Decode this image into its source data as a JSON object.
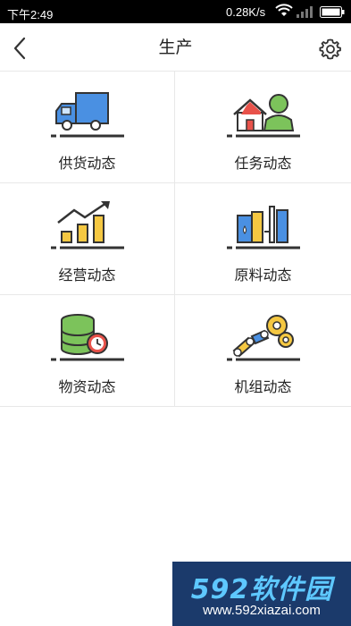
{
  "status_bar": {
    "time": "下午2:49",
    "speed": "0.28K/s"
  },
  "header": {
    "title": "生产"
  },
  "grid": [
    {
      "label": "供货动态",
      "icon": "delivery-truck-icon"
    },
    {
      "label": "任务动态",
      "icon": "task-person-house-icon"
    },
    {
      "label": "经营动态",
      "icon": "business-growth-chart-icon"
    },
    {
      "label": "原料动态",
      "icon": "raw-material-icon"
    },
    {
      "label": "物资动态",
      "icon": "supplies-database-clock-icon"
    },
    {
      "label": "机组动态",
      "icon": "machine-gears-icon"
    }
  ],
  "watermark": {
    "logo": "592软件园",
    "url": "www.592xiazai.com"
  },
  "colors": {
    "accent_blue": "#4a90e2",
    "yellow": "#f5c842",
    "green": "#7cc35b",
    "red": "#e8524a",
    "outline": "#333333"
  }
}
